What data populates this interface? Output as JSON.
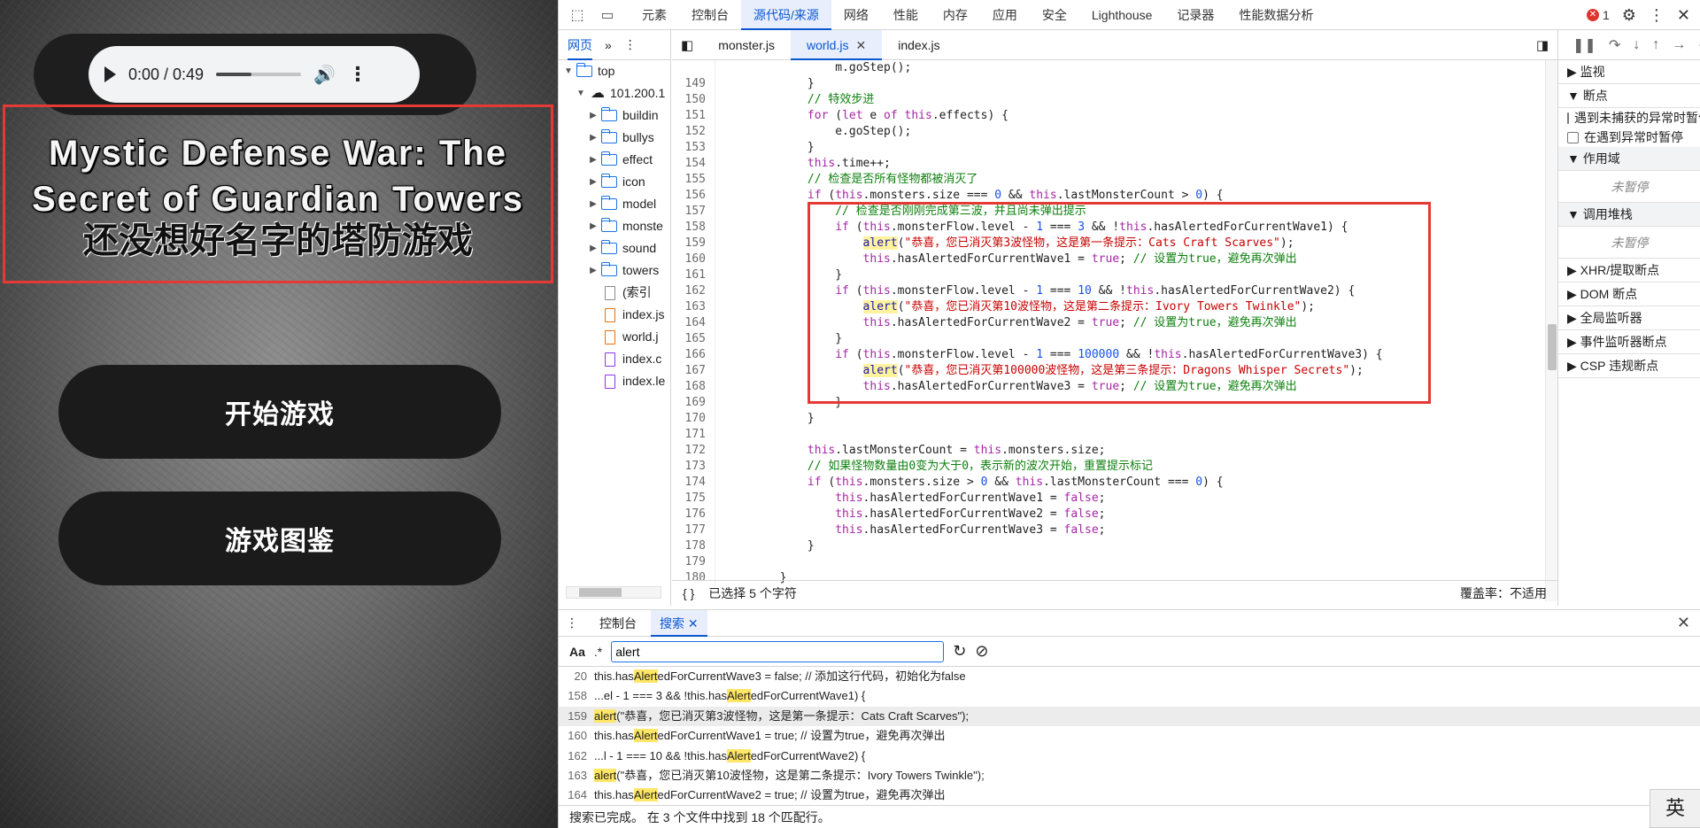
{
  "game": {
    "audio": {
      "time": "0:00 / 0:49",
      "progress": 0.42
    },
    "title_en": "Mystic Defense War: The Secret of Guardian Towers",
    "title_cn": "还没想好名字的塔防游戏",
    "buttons": [
      {
        "label": "开始游戏"
      },
      {
        "label": "游戏图鉴"
      }
    ]
  },
  "devtools": {
    "tabs": [
      "元素",
      "控制台",
      "源代码/来源",
      "网络",
      "性能",
      "内存",
      "应用",
      "安全",
      "Lighthouse",
      "记录器",
      "性能数据分析"
    ],
    "active_tab": "源代码/来源",
    "error_count": "1",
    "navigator": {
      "tab_label": "网页",
      "tree": [
        {
          "label": "top",
          "level": 0,
          "kind": "frame"
        },
        {
          "label": "101.200.1",
          "level": 1,
          "kind": "cloud"
        },
        {
          "label": "buildin",
          "level": 2,
          "kind": "folder"
        },
        {
          "label": "bullys",
          "level": 2,
          "kind": "folder"
        },
        {
          "label": "effect",
          "level": 2,
          "kind": "folder"
        },
        {
          "label": "icon",
          "level": 2,
          "kind": "folder"
        },
        {
          "label": "model",
          "level": 2,
          "kind": "folder"
        },
        {
          "label": "monste",
          "level": 2,
          "kind": "folder"
        },
        {
          "label": "sound",
          "level": 2,
          "kind": "folder"
        },
        {
          "label": "towers",
          "level": 2,
          "kind": "folder"
        },
        {
          "label": "(索引",
          "level": 2,
          "kind": "file"
        },
        {
          "label": "index.js",
          "level": 2,
          "kind": "js"
        },
        {
          "label": "world.j",
          "level": 2,
          "kind": "js"
        },
        {
          "label": "index.c",
          "level": 2,
          "kind": "css"
        },
        {
          "label": "index.le",
          "level": 2,
          "kind": "css"
        }
      ]
    },
    "file_tabs": [
      {
        "label": "monster.js",
        "active": false
      },
      {
        "label": "world.js",
        "active": true
      },
      {
        "label": "index.js",
        "active": false
      }
    ],
    "code_lines": [
      {
        "n": "",
        "t": "                m.goStep();"
      },
      {
        "n": "149",
        "t": "            }"
      },
      {
        "n": "150",
        "t": "            // 特效步进"
      },
      {
        "n": "151",
        "t": "            for (let e of this.effects) {"
      },
      {
        "n": "152",
        "t": "                e.goStep();"
      },
      {
        "n": "153",
        "t": "            }"
      },
      {
        "n": "154",
        "t": "            this.time++;"
      },
      {
        "n": "155",
        "t": "            // 检查是否所有怪物都被消灭了"
      },
      {
        "n": "156",
        "t": "            if (this.monsters.size === 0 && this.lastMonsterCount > 0) {"
      },
      {
        "n": "157",
        "t": "                // 检查是否刚刚完成第三波，并且尚未弹出提示"
      },
      {
        "n": "158",
        "t": "                if (this.monsterFlow.level - 1 === 3 && !this.hasAlertedForCurrentWave1) {"
      },
      {
        "n": "159",
        "t": "                    alert(\"恭喜，您已消灭第3波怪物，这是第一条提示：Cats Craft Scarves\");"
      },
      {
        "n": "160",
        "t": "                    this.hasAlertedForCurrentWave1 = true; // 设置为true，避免再次弹出"
      },
      {
        "n": "161",
        "t": "                }"
      },
      {
        "n": "162",
        "t": "                if (this.monsterFlow.level - 1 === 10 && !this.hasAlertedForCurrentWave2) {"
      },
      {
        "n": "163",
        "t": "                    alert(\"恭喜，您已消灭第10波怪物，这是第二条提示：Ivory Towers Twinkle\");"
      },
      {
        "n": "164",
        "t": "                    this.hasAlertedForCurrentWave2 = true; // 设置为true，避免再次弹出"
      },
      {
        "n": "165",
        "t": "                }"
      },
      {
        "n": "166",
        "t": "                if (this.monsterFlow.level - 1 === 100000 && !this.hasAlertedForCurrentWave3) {"
      },
      {
        "n": "167",
        "t": "                    alert(\"恭喜，您已消灭第100000波怪物，这是第三条提示：Dragons Whisper Secrets\");"
      },
      {
        "n": "168",
        "t": "                    this.hasAlertedForCurrentWave3 = true; // 设置为true，避免再次弹出"
      },
      {
        "n": "169",
        "t": "                }"
      },
      {
        "n": "170",
        "t": "            }"
      },
      {
        "n": "171",
        "t": ""
      },
      {
        "n": "172",
        "t": "            this.lastMonsterCount = this.monsters.size;"
      },
      {
        "n": "173",
        "t": "            // 如果怪物数量由0变为大于0，表示新的波次开始，重置提示标记"
      },
      {
        "n": "174",
        "t": "            if (this.monsters.size > 0 && this.lastMonsterCount === 0) {"
      },
      {
        "n": "175",
        "t": "                this.hasAlertedForCurrentWave1 = false;"
      },
      {
        "n": "176",
        "t": "                this.hasAlertedForCurrentWave2 = false;"
      },
      {
        "n": "177",
        "t": "                this.hasAlertedForCurrentWave3 = false;"
      },
      {
        "n": "178",
        "t": "            }"
      },
      {
        "n": "179",
        "t": ""
      },
      {
        "n": "180",
        "t": "        }"
      }
    ],
    "status": {
      "selection": "已选择 5 个字符",
      "coverage": "覆盖率：不适用"
    },
    "sidebar": {
      "sections": [
        {
          "label": "▶ 监视",
          "kind": "plain"
        },
        {
          "label": "▼ 断点",
          "kind": "plain"
        },
        {
          "label": "遇到未捕获的异常时暂停",
          "kind": "check"
        },
        {
          "label": "在遇到异常时暂停",
          "kind": "check"
        },
        {
          "label": "▼ 作用域",
          "kind": "head"
        },
        {
          "label": "未暂停",
          "kind": "empty"
        },
        {
          "label": "▼ 调用堆栈",
          "kind": "head"
        },
        {
          "label": "未暂停",
          "kind": "empty"
        },
        {
          "label": "▶ XHR/提取断点",
          "kind": "plain"
        },
        {
          "label": "▶ DOM 断点",
          "kind": "plain"
        },
        {
          "label": "▶ 全局监听器",
          "kind": "plain"
        },
        {
          "label": "▶ 事件监听器断点",
          "kind": "plain"
        },
        {
          "label": "▶ CSP 违规断点",
          "kind": "plain"
        }
      ]
    },
    "drawer": {
      "tabs": [
        {
          "label": "控制台",
          "active": false
        },
        {
          "label": "搜索",
          "active": true
        }
      ],
      "search": {
        "case_label": "Aa",
        "regex_label": ".*",
        "value": "alert"
      },
      "results": [
        {
          "n": "20",
          "pre": "this.has",
          "m": "Alert",
          "post": "edForCurrentWave3 = false; // 添加这行代码，初始化为false"
        },
        {
          "n": "158",
          "pre": "...el - 1 === 3 && !this.has",
          "m": "Alert",
          "post": "edForCurrentWave1) {"
        },
        {
          "n": "159",
          "pre": "",
          "m": "alert",
          "post": "(\"恭喜，您已消灭第3波怪物，这是第一条提示：Cats Craft Scarves\");",
          "selected": true
        },
        {
          "n": "160",
          "pre": "this.has",
          "m": "Alert",
          "post": "edForCurrentWave1 = true; // 设置为true，避免再次弹出"
        },
        {
          "n": "162",
          "pre": "...l - 1 === 10 && !this.has",
          "m": "Alert",
          "post": "edForCurrentWave2) {"
        },
        {
          "n": "163",
          "pre": "",
          "m": "alert",
          "post": "(\"恭喜，您已消灭第10波怪物，这是第二条提示：Ivory Towers Twinkle\");"
        },
        {
          "n": "164",
          "pre": "this.has",
          "m": "Alert",
          "post": "edForCurrentWave2 = true; // 设置为true，避免再次弹出"
        }
      ],
      "footer": "搜索已完成。  在 3 个文件中找到 18 个匹配行。"
    },
    "ime": "英"
  }
}
